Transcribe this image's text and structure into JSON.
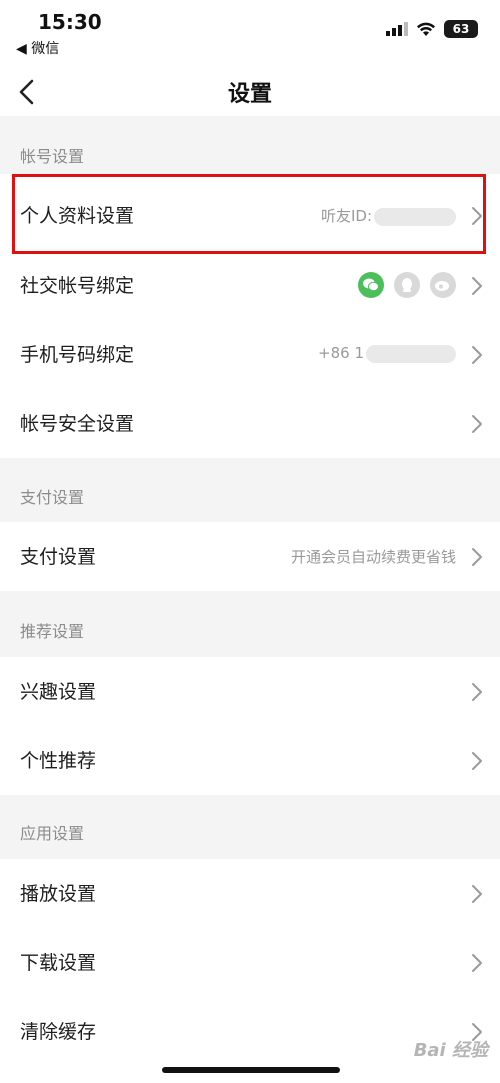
{
  "status": {
    "time": "15:30",
    "back_app": "◀ 微信",
    "battery": "63"
  },
  "nav": {
    "title": "设置"
  },
  "sections": {
    "account": "帐号设置",
    "payment": "支付设置",
    "recommend": "推荐设置",
    "app": "应用设置"
  },
  "rows": {
    "profile": {
      "label": "个人资料设置",
      "value": "听友ID:"
    },
    "social": {
      "label": "社交帐号绑定"
    },
    "phone": {
      "label": "手机号码绑定",
      "value": "+86 1"
    },
    "security": {
      "label": "帐号安全设置"
    },
    "pay": {
      "label": "支付设置",
      "value": "开通会员自动续费更省钱"
    },
    "interest": {
      "label": "兴趣设置"
    },
    "personal_rec": {
      "label": "个性推荐"
    },
    "playback": {
      "label": "播放设置"
    },
    "download": {
      "label": "下载设置"
    },
    "cache": {
      "label": "清除缓存"
    }
  },
  "social_icons": [
    "wechat-icon",
    "qq-icon",
    "weibo-icon"
  ],
  "colors": {
    "accent_highlight": "#e01010",
    "wechat": "#4cbf5b",
    "section_bg": "#f4f4f4"
  },
  "watermark": "Bai 经验"
}
